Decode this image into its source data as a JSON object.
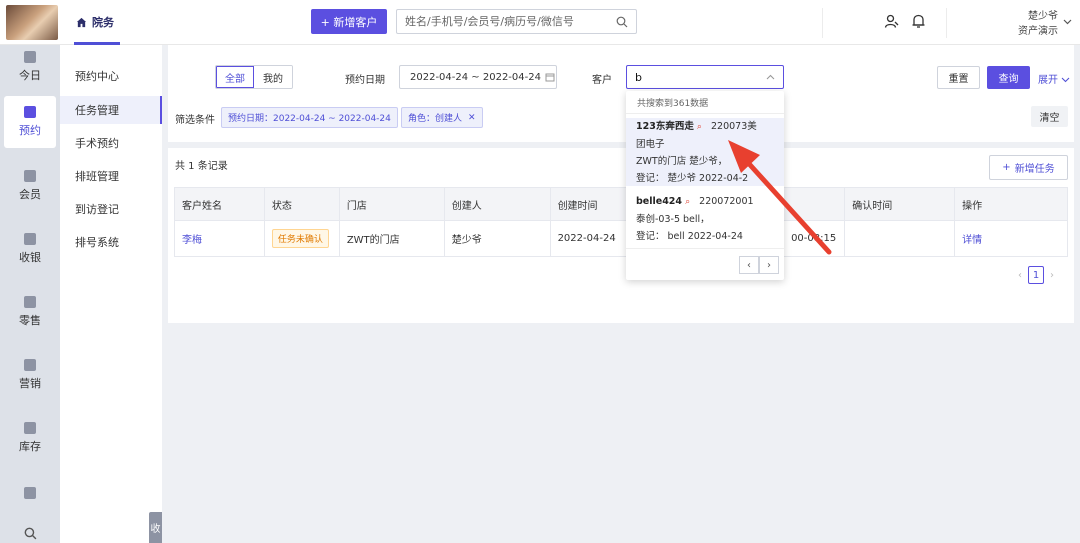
{
  "header": {
    "brand_label": "院务",
    "add_customer_label": "+ 新增客户",
    "search_placeholder": "姓名/手机号/会员号/病历号/微信号",
    "user_name": "楚少爷",
    "user_org": "资产演示"
  },
  "leftnav": {
    "items": [
      {
        "label": "今日",
        "icon": "calendar-check-icon"
      },
      {
        "label": "预约",
        "icon": "calendar-icon"
      },
      {
        "label": "会员",
        "icon": "members-icon"
      },
      {
        "label": "收银",
        "icon": "cashier-icon"
      },
      {
        "label": "零售",
        "icon": "bag-icon"
      },
      {
        "label": "营销",
        "icon": "bookmark-icon"
      },
      {
        "label": "库存",
        "icon": "box-icon"
      },
      {
        "label": "",
        "icon": "medical-kit-icon"
      },
      {
        "label": "",
        "icon": "search-icon"
      }
    ]
  },
  "subnav": {
    "items": [
      {
        "label": "预约中心"
      },
      {
        "label": "任务管理"
      },
      {
        "label": "手术预约"
      },
      {
        "label": "排班管理"
      },
      {
        "label": "到访登记"
      },
      {
        "label": "排号系统"
      }
    ],
    "collapse_label": "收"
  },
  "filters": {
    "seg_all": "全部",
    "seg_mine": "我的",
    "date_label": "预约日期",
    "date_range": "2022-04-24 ~ 2022-04-24",
    "customer_label": "客户",
    "customer_value": "b",
    "reset_label": "重置",
    "query_label": "查询",
    "expand_label": "展开",
    "filter_condition_label": "筛选条件",
    "tag_date": "预约日期：2022-04-24 ~ 2022-04-24",
    "tag_role": "角色：创建人",
    "clear_label": "清空"
  },
  "results": {
    "total_text": "共 1 条记录",
    "new_task_label": "新增任务",
    "columns": [
      "客户姓名",
      "状态",
      "门店",
      "创建人",
      "创建时间",
      "",
      "确认时间",
      "操作"
    ],
    "rows": [
      {
        "name": "李梅",
        "status": "任务未确认",
        "store": "ZWT的门店",
        "creator": "楚少爷",
        "created": "2022-04-24",
        "extra": "00-08:15",
        "confirmed": "",
        "action": "详情"
      }
    ],
    "page": "1"
  },
  "dropdown": {
    "count_text": "共搜索到361数据",
    "items": [
      {
        "name": "123东奔西走",
        "id": "220073美",
        "line2": "团电子",
        "line3": "ZWT的门店 楚少爷，",
        "line4": "登记：  楚少爷  2022-04-2"
      },
      {
        "name": "belle424",
        "id": "220072001",
        "line2": "泰创-03-5 bell，",
        "line3": "登记：  bell  2022-04-24"
      }
    ]
  },
  "colors": {
    "accent": "#5b4fe0",
    "annotation_arrow": "#e8402f"
  }
}
